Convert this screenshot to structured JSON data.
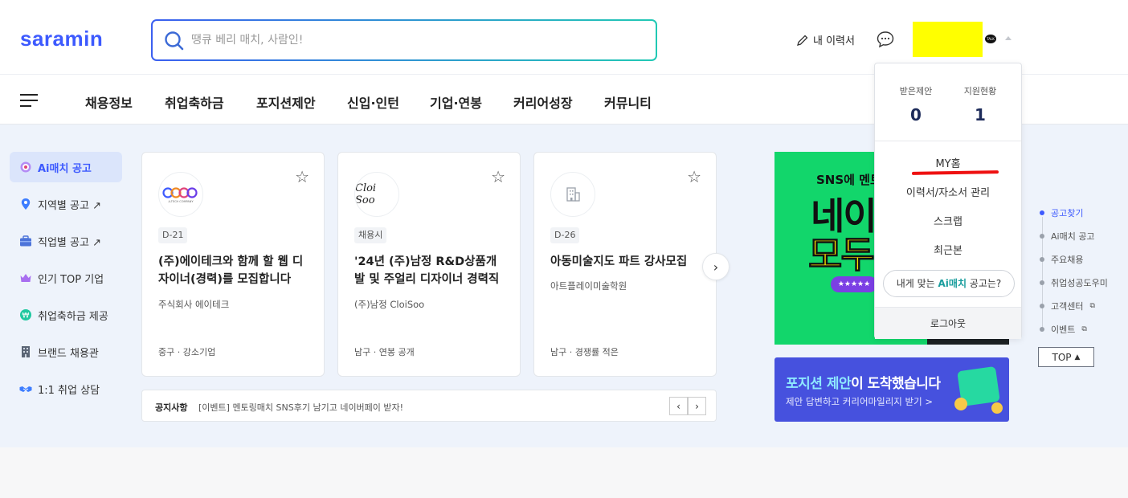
{
  "header": {
    "logo": "saramin",
    "search_placeholder": "땡큐 베리 매치, 사람인!",
    "resume_label": "내 이력서"
  },
  "nav": {
    "items": [
      "채용정보",
      "취업축하금",
      "포지션제안",
      "신입·인턴",
      "기업·연봉",
      "커리어성장",
      "커뮤니티"
    ]
  },
  "sidebar": {
    "items": [
      {
        "label": "Ai매치 공고",
        "icon": "target-icon"
      },
      {
        "label": "지역별 공고 ↗",
        "icon": "map-pin-icon"
      },
      {
        "label": "직업별 공고 ↗",
        "icon": "briefcase-icon"
      },
      {
        "label": "인기 TOP 기업",
        "icon": "crown-icon"
      },
      {
        "label": "취업축하금 제공",
        "icon": "coin-icon"
      },
      {
        "label": "브랜드 채용관",
        "icon": "building-icon"
      },
      {
        "label": "1:1 취업 상담",
        "icon": "handshake-icon"
      }
    ]
  },
  "cards": [
    {
      "badge": "D-21",
      "title": "(주)에이테크와 함께 할 웹 디자이너(경력)를 모집합니다",
      "company": "주식회사 에이테크",
      "meta": "중구 · 강소기업",
      "logo_text": "A-TECH COMPANY"
    },
    {
      "badge": "채용시",
      "title": "'24년 (주)남정 R&D상품개발 및 주얼리 디자이너 경력직 ...",
      "company": "(주)남정 CloiSoo",
      "meta": "남구 · 연봉 공개",
      "logo_text": "Cloi Soo"
    },
    {
      "badge": "D-26",
      "title": "아동미술지도 파트 강사모집",
      "company": "아트플레이미술학원",
      "meta": "남구 · 경쟁률 적은",
      "logo_text": ""
    }
  ],
  "notice": {
    "label": "공지사항",
    "text": "[이벤트] 멘토링매치 SNS후기 남기고 네이버페이 받자!"
  },
  "banner1": {
    "sub": "SNS에 멘토",
    "big1": "네이",
    "big2": "모두",
    "pill": "★★★★★"
  },
  "banner2": {
    "title_strong": "포지션 제안",
    "title_rest": "이 도착했습니다",
    "sub": "제안 답변하고 커리어마일리지 받기 >"
  },
  "quicknav": {
    "items": [
      "공고찾기",
      "Ai매치 공고",
      "주요채용",
      "취업성공도우미",
      "고객센터",
      "이벤트"
    ],
    "top_label": "TOP"
  },
  "dropdown": {
    "received_label": "받은제안",
    "received_count": "0",
    "applied_label": "지원현황",
    "applied_count": "1",
    "links": [
      "MY홈",
      "이력서/자소서 관리",
      "스크랩",
      "최근본"
    ],
    "ai_prefix": "내게 맞는 ",
    "ai_strong": "Ai매치",
    "ai_suffix": " 공고는?",
    "logout": "로그아웃"
  },
  "colors": {
    "brand": "#3d5afe",
    "highlight_yellow": "#ffff00",
    "red_underline": "#ee1111"
  }
}
